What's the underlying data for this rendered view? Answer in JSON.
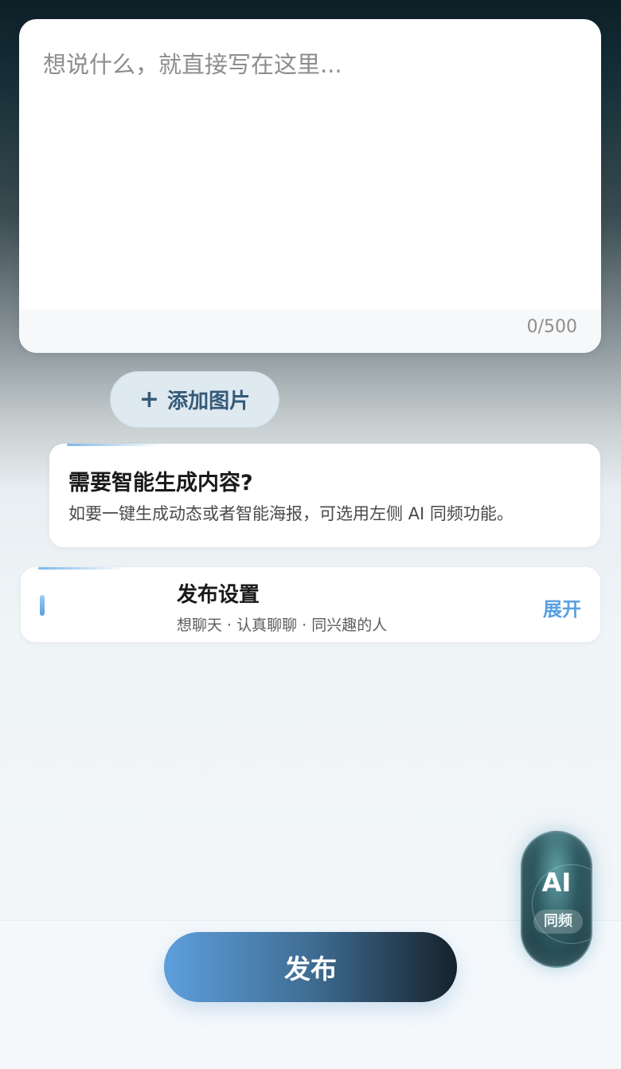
{
  "composer": {
    "placeholder": "想说什么，就直接写在这里...",
    "value": "",
    "counter": "0/500"
  },
  "add_image": {
    "icon": "plus-icon",
    "plus_glyph": "+",
    "label": "添加图片"
  },
  "hint": {
    "title": "需要智能生成内容?",
    "description": "如要一键生成动态或者智能海报，可选用左侧 AI 同频功能。"
  },
  "publish_settings": {
    "title": "发布设置",
    "summary": "想聊天 · 认真聊聊 · 同兴趣的人",
    "expand_label": "展开"
  },
  "publish_button": {
    "label": "发布"
  },
  "ai_fab": {
    "title": "AI",
    "subtitle": "同频"
  },
  "colors": {
    "accent_blue": "#5aa0e0",
    "publish_gradient_start": "#5e9fdc",
    "publish_gradient_end": "#16222b"
  }
}
